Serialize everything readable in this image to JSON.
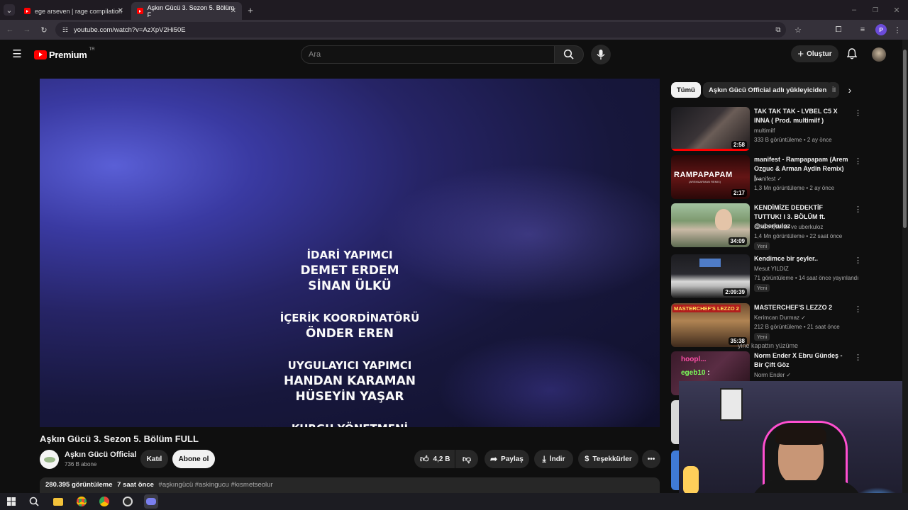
{
  "browser": {
    "tabs": [
      {
        "label": "ege arseven | rage compilation"
      },
      {
        "label": "Aşkın Gücü 3. Sezon 5. Bölüm F"
      }
    ],
    "url": "youtube.com/watch?v=AzXpV2Hi50E",
    "profile_letter": "P"
  },
  "header": {
    "logo": "Premium",
    "region": "TR",
    "search_placeholder": "Ara",
    "create_label": "Oluştur"
  },
  "video": {
    "credits": [
      {
        "lines": [
          "İDARİ YAPIMCI",
          "DEMET ERDEM",
          "SİNAN ÜLKÜ"
        ]
      },
      {
        "lines": [
          "İÇERİK KOORDİNATÖRÜ",
          "ÖNDER EREN"
        ]
      },
      {
        "lines": [
          "UYGULAYICI YAPIMCI",
          "HANDAN KARAMAN",
          "HÜSEYİN YAŞAR"
        ]
      },
      {
        "lines": [
          "KURGU YÖNETMENİ"
        ]
      }
    ],
    "title": "Aşkın Gücü 3. Sezon 5. Bölüm FULL",
    "channel": "Aşkın Gücü Official",
    "subscribers": "736 B abone",
    "join_label": "Katıl",
    "subscribe_label": "Abone ol",
    "likes": "4,2 B",
    "share_label": "Paylaş",
    "download_label": "İndir",
    "thanks_label": "Teşekkürler",
    "views": "280.395 görüntüleme",
    "age": "7 saat önce",
    "hashtags": "#aşkıngücü #askingucu #kısmetseolur"
  },
  "chips": [
    "Tümü",
    "Aşkın Gücü Official adlı yükleyiciden",
    "İl"
  ],
  "recommendations": [
    {
      "title": "TAK TAK TAK - LVBEL C5 X INNA ( Prod. multimilf )",
      "channel": "multimilf",
      "meta": "333 B görüntüleme • 2 ay önce",
      "duration": "2:58",
      "badge": ""
    },
    {
      "title": "manifest - Rampapapam (Arem Ozguc & Arman Aydin Remix) |...",
      "channel": "manifest",
      "meta": "1,3 Mn görüntüleme • 2 ay önce",
      "duration": "2:17",
      "badge": ""
    },
    {
      "title": "KENDİMİZE DEDEKTİF TUTTUK! l 3. BÖLÜM ft. @uberkuloz",
      "channel": "Orkun Işıtmak  ve uberkuloz",
      "meta": "1,4 Mn görüntüleme • 22 saat önce",
      "duration": "34:09",
      "badge": "Yeni"
    },
    {
      "title": "Kendimce bir şeyler..",
      "channel": "Mesut YILDIZ",
      "meta": "71 görüntüleme • 14 saat önce yayınlandı",
      "duration": "2:09:39",
      "badge": "Yeni"
    },
    {
      "title": "MASTERCHEF'S LEZZO 2",
      "channel": "Kerimcan Durmaz",
      "meta": "212 B görüntüleme • 21 saat önce",
      "duration": "35:38",
      "badge": "Yeni"
    },
    {
      "title": "Norm Ender X Ebru Gündeş - Bir Çift Göz",
      "channel": "Norm Ender",
      "meta": "",
      "duration": "",
      "badge": ""
    }
  ],
  "thumb_texts": [
    "RAMPAPAPAM",
    "(AREM&ARMAN REMIX)",
    "MASTERCHEF'S LEZZO 2"
  ],
  "overlay_chat": [
    {
      "user": "",
      "text": "yine kapattın yüzüme"
    },
    {
      "user": "hoopl...",
      "text": ""
    },
    {
      "user": "egeb10",
      "text": ":"
    }
  ],
  "colors": {
    "accent_red": "#ff0000",
    "bg": "#0f0f0f",
    "chip_active": "#f1f1f1"
  }
}
